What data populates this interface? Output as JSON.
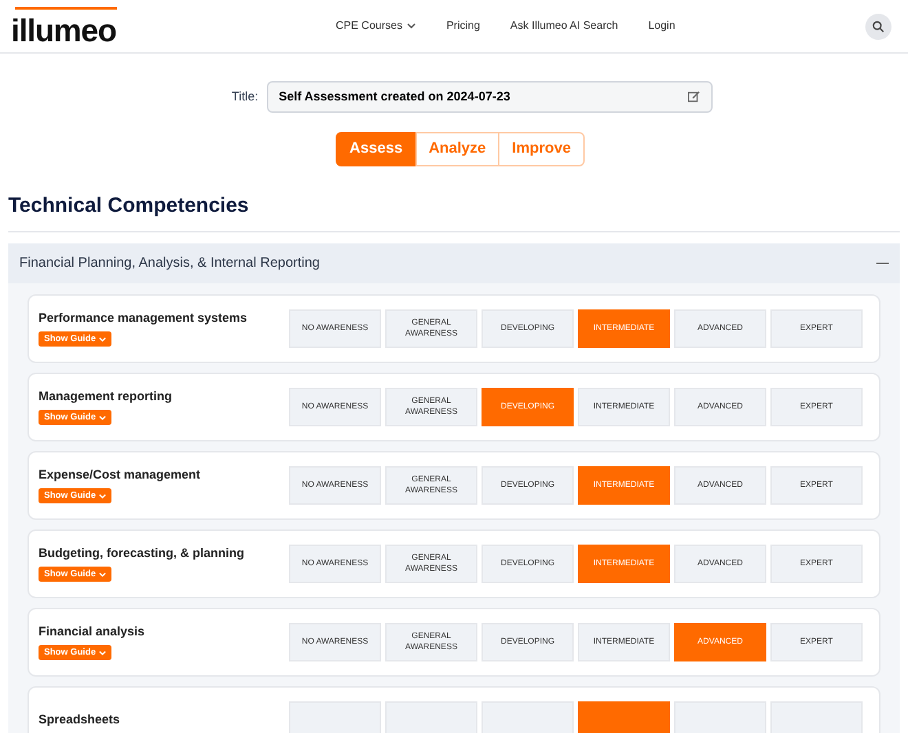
{
  "header": {
    "logo": "illumeo",
    "nav": [
      {
        "label": "CPE Courses",
        "dropdown": true
      },
      {
        "label": "Pricing",
        "dropdown": false
      },
      {
        "label": "Ask Illumeo AI Search",
        "dropdown": false
      },
      {
        "label": "Login",
        "dropdown": false
      }
    ]
  },
  "title_field": {
    "label": "Title:",
    "value": "Self Assessment created on 2024-07-23"
  },
  "tabs": [
    {
      "label": "Assess",
      "selected": true
    },
    {
      "label": "Analyze",
      "selected": false
    },
    {
      "label": "Improve",
      "selected": false
    }
  ],
  "heading": "Technical Competencies",
  "section": {
    "title": "Financial Planning, Analysis, & Internal Reporting",
    "expanded": true,
    "competencies": [
      {
        "name": "Performance management systems",
        "guide": "Show Guide",
        "options": [
          {
            "label": "NO AWARENESS",
            "selected": false
          },
          {
            "label": "GENERAL AWARENESS",
            "selected": false
          },
          {
            "label": "DEVELOPING",
            "selected": false
          },
          {
            "label": "INTERMEDIATE",
            "selected": true
          },
          {
            "label": "ADVANCED",
            "selected": false
          },
          {
            "label": "EXPERT",
            "selected": false
          }
        ]
      },
      {
        "name": "Management reporting",
        "guide": "Show Guide",
        "options": [
          {
            "label": "NO AWARENESS",
            "selected": false
          },
          {
            "label": "GENERAL AWARENESS",
            "selected": false
          },
          {
            "label": "DEVELOPING",
            "selected": true
          },
          {
            "label": "INTERMEDIATE",
            "selected": false
          },
          {
            "label": "ADVANCED",
            "selected": false
          },
          {
            "label": "EXPERT",
            "selected": false
          }
        ]
      },
      {
        "name": "Expense/Cost management",
        "guide": "Show Guide",
        "options": [
          {
            "label": "NO AWARENESS",
            "selected": false
          },
          {
            "label": "GENERAL AWARENESS",
            "selected": false
          },
          {
            "label": "DEVELOPING",
            "selected": false
          },
          {
            "label": "INTERMEDIATE",
            "selected": true
          },
          {
            "label": "ADVANCED",
            "selected": false
          },
          {
            "label": "EXPERT",
            "selected": false
          }
        ]
      },
      {
        "name": "Budgeting, forecasting, & planning",
        "guide": "Show Guide",
        "options": [
          {
            "label": "NO AWARENESS",
            "selected": false
          },
          {
            "label": "GENERAL AWARENESS",
            "selected": false
          },
          {
            "label": "DEVELOPING",
            "selected": false
          },
          {
            "label": "INTERMEDIATE",
            "selected": true
          },
          {
            "label": "ADVANCED",
            "selected": false
          },
          {
            "label": "EXPERT",
            "selected": false
          }
        ]
      },
      {
        "name": "Financial analysis",
        "guide": "Show Guide",
        "options": [
          {
            "label": "NO AWARENESS",
            "selected": false
          },
          {
            "label": "GENERAL AWARENESS",
            "selected": false
          },
          {
            "label": "DEVELOPING",
            "selected": false
          },
          {
            "label": "INTERMEDIATE",
            "selected": false
          },
          {
            "label": "ADVANCED",
            "selected": true
          },
          {
            "label": "EXPERT",
            "selected": false
          }
        ]
      },
      {
        "name": "Spreadsheets",
        "options": [
          {
            "selected": false
          },
          {
            "selected": false
          },
          {
            "selected": false
          },
          {
            "selected": true
          },
          {
            "selected": false
          },
          {
            "selected": false
          }
        ]
      }
    ]
  }
}
